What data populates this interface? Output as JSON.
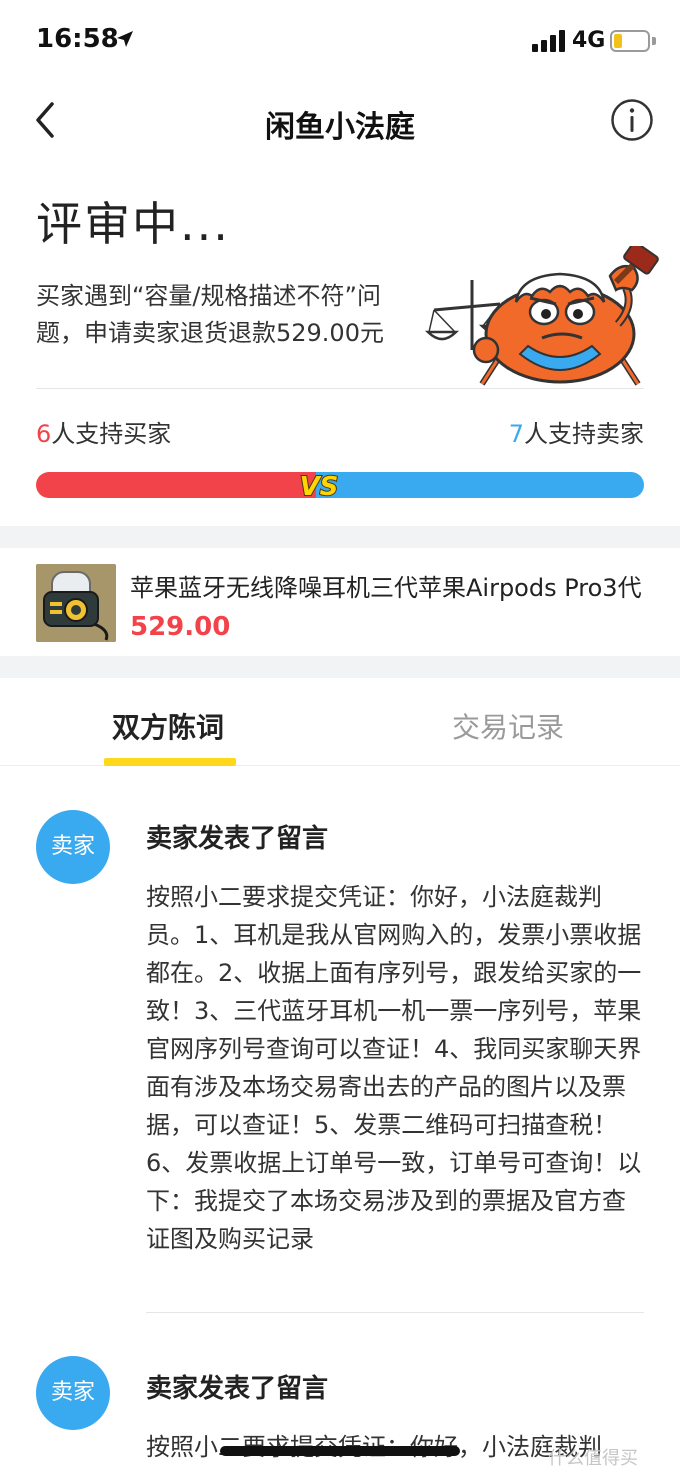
{
  "status_bar": {
    "time": "16:58",
    "network": "4G",
    "battery_level": 0.25
  },
  "nav": {
    "title": "闲鱼小法庭"
  },
  "case": {
    "status": "评审中...",
    "description": "买家遇到“容量/规格描述不符”问题，申请卖家退货退款529.00元"
  },
  "votes": {
    "buyer_count": "6",
    "buyer_label": "人支持买家",
    "seller_count": "7",
    "seller_label": "人支持卖家",
    "vs_label": "VS",
    "buyer_share": 0.46,
    "buyer_color": "#f2434a",
    "seller_color": "#3aaaf0"
  },
  "product": {
    "title": "苹果蓝牙无线降噪耳机三代苹果Airpods Pro3代",
    "price": "529.00"
  },
  "tabs": [
    {
      "label": "双方陈词",
      "active": true
    },
    {
      "label": "交易记录",
      "active": false
    }
  ],
  "messages": [
    {
      "avatar": "卖家",
      "title": "卖家发表了留言",
      "body": "按照小二要求提交凭证：你好，小法庭裁判员。1、耳机是我从官网购入的，发票小票收据都在。2、收据上面有序列号，跟发给买家的一致！3、三代蓝牙耳机一机一票一序列号，苹果官网序列号查询可以查证！4、我同买家聊天界面有涉及本场交易寄出去的产品的图片以及票据，可以查证！5、发票二维码可扫描查税！6、发票收据上订单号一致，订单号可查询！以下：我提交了本场交易涉及到的票据及官方查证图及购买记录"
    },
    {
      "avatar": "卖家",
      "title": "卖家发表了留言",
      "body": "按照小二要求提交凭证：你好，小法庭裁判"
    }
  ],
  "watermark": "什么值得买"
}
